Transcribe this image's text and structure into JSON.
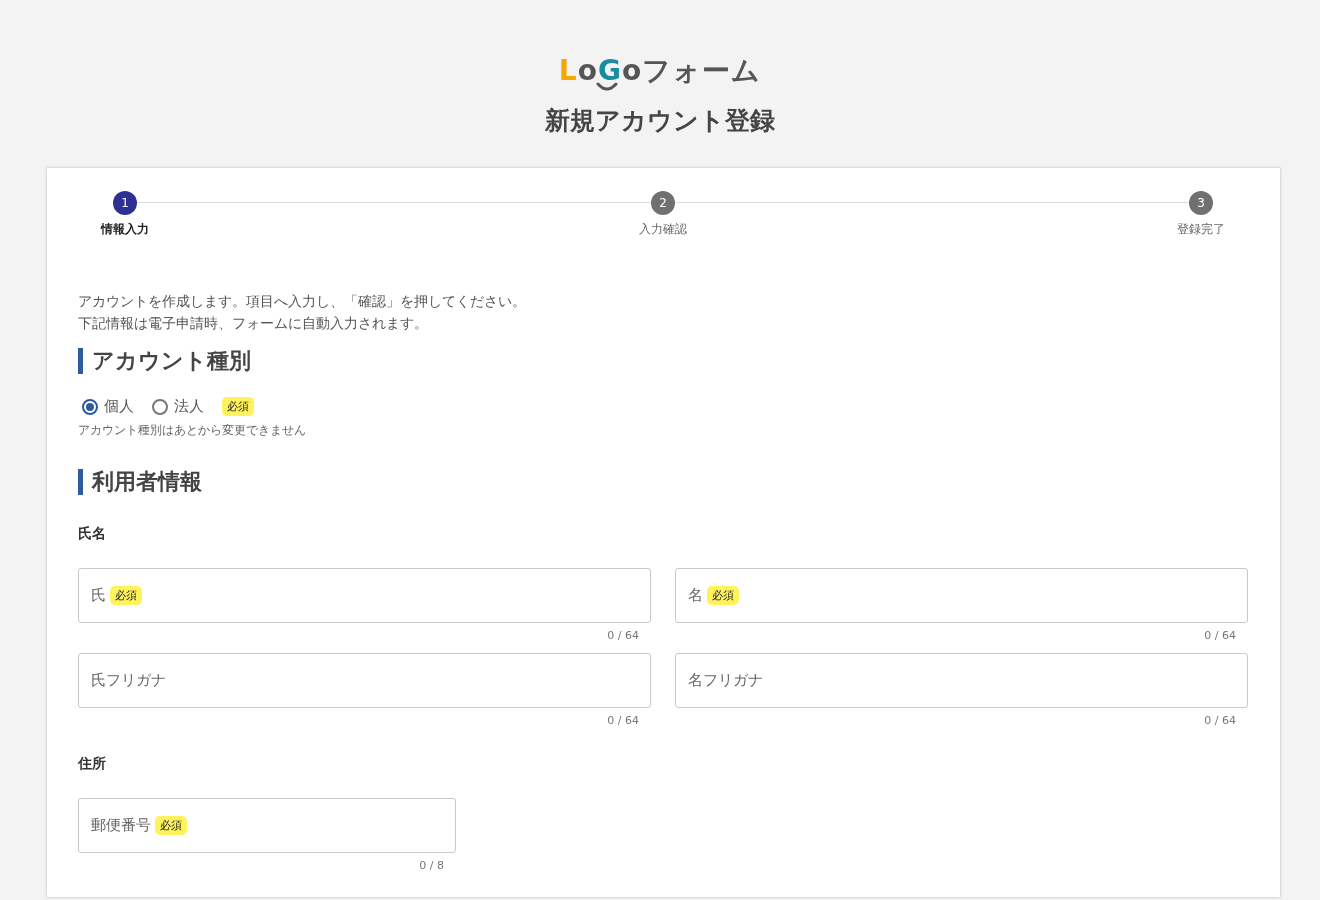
{
  "logo": [
    {
      "text": "L",
      "color": "#f5a800"
    },
    {
      "text": "o",
      "color": "#555555"
    },
    {
      "text": "G",
      "color": "#1a8ca0"
    },
    {
      "text": "o",
      "color": "#555555"
    },
    {
      "text": "フォーム",
      "color": "#555555"
    }
  ],
  "title": "新規アカウント登録",
  "steps": [
    {
      "number": "1",
      "label": "情報入力",
      "selected": true
    },
    {
      "number": "2",
      "label": "入力確認",
      "selected": false
    },
    {
      "number": "3",
      "label": "登録完了",
      "selected": false
    }
  ],
  "intro": [
    "アカウントを作成します。項目へ入力し、「確認」を押してください。",
    "下記情報は電子申請時、フォームに自動入力されます。"
  ],
  "sections": [
    {
      "heading": "アカウント種別",
      "blocks": [
        {
          "kind": "radio",
          "options": [
            {
              "label": "個人",
              "selected": true
            },
            {
              "label": "法人",
              "selected": false
            }
          ],
          "required": "必須",
          "note": "アカウント種別はあとから変更できません"
        }
      ]
    },
    {
      "heading": "利用者情報",
      "blocks": [
        {
          "kind": "group",
          "label": "氏名",
          "rows": [
            [
              {
                "placeholder": "氏",
                "required": "必須",
                "counter": "0 / 64"
              },
              {
                "placeholder": "名",
                "required": "必須",
                "counter": "0 / 64"
              }
            ],
            [
              {
                "placeholder": "氏フリガナ",
                "counter": "0 / 64"
              },
              {
                "placeholder": "名フリガナ",
                "counter": "0 / 64"
              }
            ]
          ]
        },
        {
          "kind": "group",
          "label": "住所",
          "rows": [
            [
              {
                "placeholder": "郵便番号",
                "required": "必須",
                "counter": "0 / 8",
                "narrow": true
              }
            ]
          ]
        }
      ]
    }
  ]
}
